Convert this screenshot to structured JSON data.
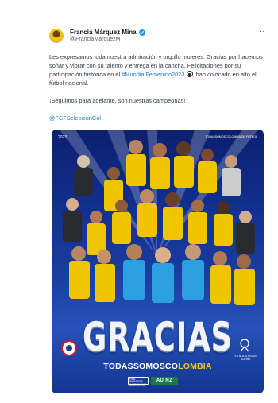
{
  "author": {
    "name": "Francia Márquez Mina",
    "handle": "@FranciaMarquezM",
    "verified": true,
    "avatar": "avatar"
  },
  "menu": {
    "more_label": "···"
  },
  "tweet": {
    "line1": "Les expresamos toda nuestra admiración y orgullo mujeres. Gracias por hacernos soñar y vibrar con su talento y entrega en la cancha. Felicitaciones por su participación histórica en el ",
    "hashtag": "#MundialFemenino2023",
    "line1_end": ", han colocado en alto el fútbol nacional.",
    "line2": "¡Seguimos para adelante, son nuestras campeonas!",
    "mention": "@FCFSeleccionCol"
  },
  "poster": {
    "year": "2023",
    "top_text": "TODASSOMOSCOLOMBIA DE FÚTBOL",
    "headline": "GRACIAS",
    "subline_a": "TODASSOMOSCO",
    "subline_b": "LOMBIA",
    "fifa_text": "FIFA WOMEN'S WORLD CUP",
    "wc_text": "AU NZ",
    "right_badge_text": "FUTBOLISTAS UN SUEÑO",
    "colors": {
      "navy": "#12308f",
      "yellow": "#f5c518",
      "red": "#c41e2e"
    }
  }
}
